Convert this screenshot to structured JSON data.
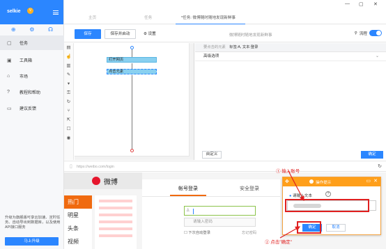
{
  "app": {
    "logo": "selkie",
    "badge": "V"
  },
  "sidebar": {
    "top_icons": [
      "plus-icon",
      "gear-icon",
      "headset-icon"
    ],
    "items": [
      {
        "label": "任务",
        "icon": "task-icon"
      },
      {
        "label": "工具箱",
        "icon": "toolbox-icon"
      },
      {
        "label": "市场",
        "icon": "market-icon"
      },
      {
        "label": "教程和帮助",
        "icon": "help-icon"
      },
      {
        "label": "建议反馈",
        "icon": "feedback-icon"
      }
    ],
    "note": "升级为旗舰版可享云加速、定时任务、自动导出到数据库，以及使用API接口服务",
    "upgrade_button": "马上升级"
  },
  "tabs": [
    {
      "label": "主页"
    },
    {
      "label": "任务"
    },
    {
      "label": "*任务: 微博随时随地发现新鲜事"
    }
  ],
  "toolbar": {
    "save": "保存",
    "save_run": "保存并启动",
    "settings": "设置",
    "title": "微博随时随地发现新鲜事",
    "flow_label": "流程"
  },
  "flow": {
    "nodes": [
      "打开网页",
      "点击元素"
    ]
  },
  "props": {
    "selected_label": "要点击的元素",
    "selected_value": "标签:A, 文本:登录",
    "advanced": "高级选项",
    "custom_button": "自定义",
    "ok_button": "确定"
  },
  "urlbar": {
    "url": "https://weibo.com/login"
  },
  "weibo": {
    "name": "微博",
    "nav": [
      "热门",
      "明星",
      "头条",
      "视频"
    ],
    "tab_account": "帐号登录",
    "tab_secure": "安全登录",
    "password_placeholder": "请输入密码",
    "remember": "下次自动登录",
    "forgot": "忘记密码"
  },
  "dialog": {
    "title": "操作提示",
    "label": "请输入文本",
    "ok": "确定",
    "cancel": "取消"
  },
  "annotations": {
    "step1": "①  输入账号",
    "step2": "② 点击\"确定\""
  },
  "colors": {
    "accent": "#2b86ff",
    "dialog_header": "#ff9f1a",
    "annotation": "#e02020"
  }
}
